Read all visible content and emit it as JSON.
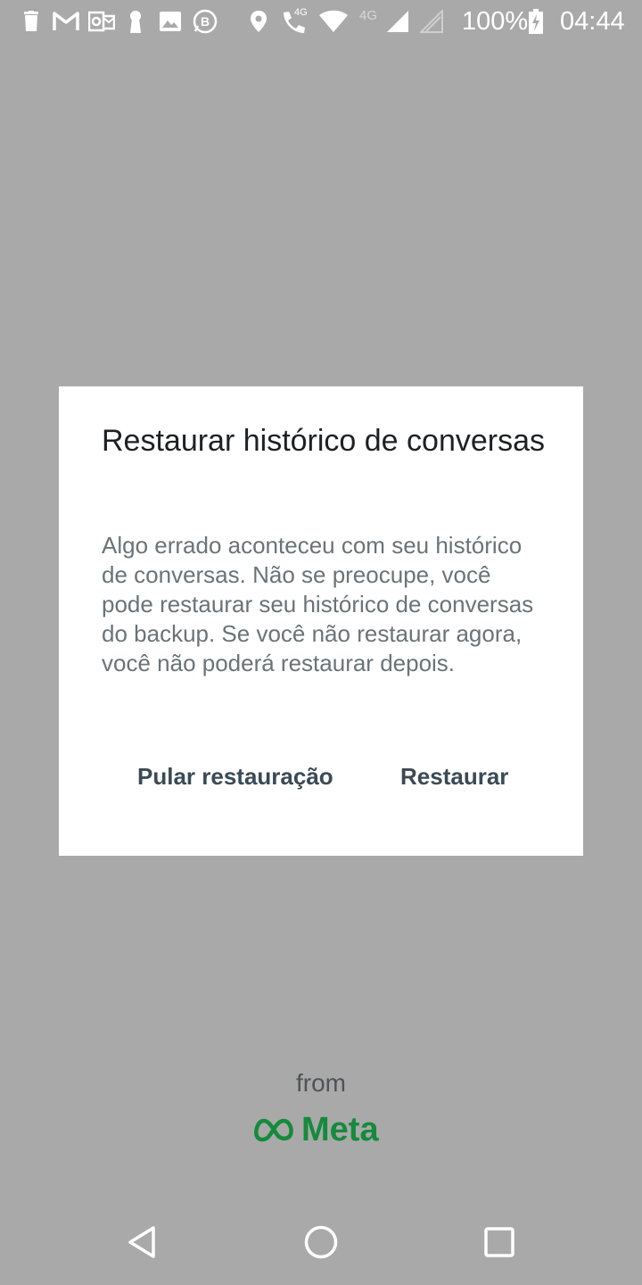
{
  "status_bar": {
    "network_small_label": "4G",
    "call_small_label": "4G",
    "battery_percent": "100%",
    "time": "04:44",
    "icons": [
      "delete-icon",
      "gmail-icon",
      "outlook-icon",
      "keyhole-icon",
      "gallery-icon",
      "b-icon",
      "location-icon",
      "wifi-call-icon",
      "wifi-icon",
      "signal-icon",
      "signal-empty-icon",
      "battery-charging-icon"
    ]
  },
  "dialog": {
    "title": "Restaurar histórico de conversas",
    "body": "Algo errado aconteceu com seu histórico de conversas. Não se preocupe, você pode restaurar seu histórico de conversas do backup. Se você não restaurar agora, você não poderá restaurar depois.",
    "skip_label": "Pular restauração",
    "restore_label": "Restaurar"
  },
  "branding": {
    "from_label": "from",
    "meta_label": "Meta",
    "meta_color": "#158a3c"
  },
  "nav_bar": {
    "icons": [
      "back-icon",
      "home-icon",
      "recents-icon"
    ]
  },
  "colors": {
    "scrim": "#a9a9a9",
    "dialog_bg": "#ffffff",
    "button_text": "#3b4a55"
  }
}
